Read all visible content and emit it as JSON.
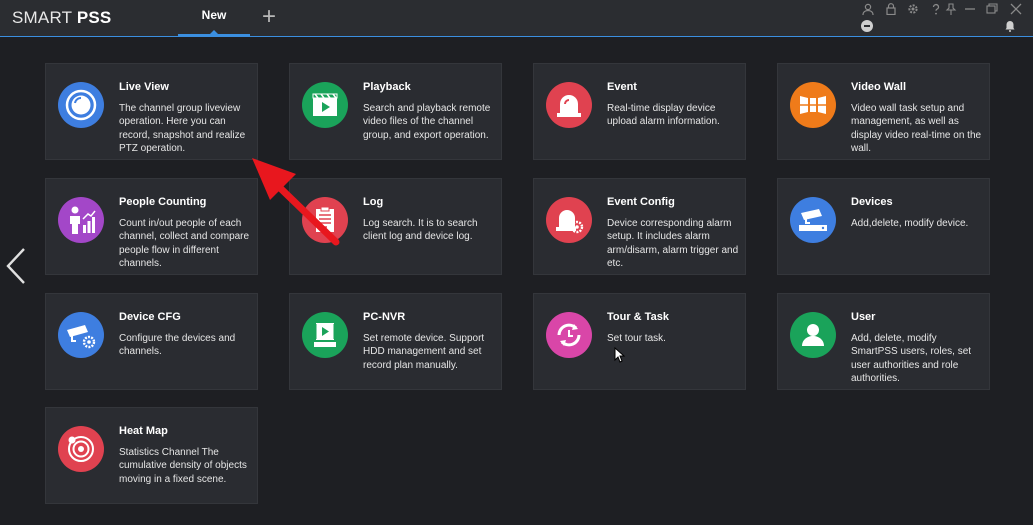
{
  "app": {
    "logo_part1": "SMART ",
    "logo_part2": "PSS",
    "active_tab": "New",
    "add_tab": "+"
  },
  "colors": {
    "live_view": "#3e7ee0",
    "playback": "#1aa35a",
    "event": "#e04250",
    "video_wall": "#ef7b1a",
    "people_counting": "#a347c8",
    "log": "#e04250",
    "event_config": "#e04250",
    "devices": "#3e7ee0",
    "device_cfg": "#3e7ee0",
    "pc_nvr": "#1aa35a",
    "tour_task": "#d946a8",
    "user": "#1aa35a",
    "heat_map": "#e04250"
  },
  "cards": [
    {
      "title": "Live View",
      "desc": "The channel group liveview operation. Here you can record, snapshot and realize PTZ operation.",
      "icon": "live-view-icon"
    },
    {
      "title": "Playback",
      "desc": "Search and playback remote video files of the channel group, and export operation.",
      "icon": "playback-icon"
    },
    {
      "title": "Event",
      "desc": "Real-time display device upload alarm information.",
      "icon": "alarm-light-icon"
    },
    {
      "title": "Video Wall",
      "desc": "Video wall task setup and management, as well as display video real-time on the wall.",
      "icon": "video-wall-icon"
    },
    {
      "title": "People Counting",
      "desc": "Count in/out people of each channel, collect and compare people flow in different channels.",
      "icon": "people-counting-icon"
    },
    {
      "title": "Log",
      "desc": "Log search. It is to search client log and device log.",
      "icon": "log-icon"
    },
    {
      "title": "Event Config",
      "desc": "Device corresponding alarm setup. It includes alarm arm/disarm, alarm trigger and etc.",
      "icon": "event-config-icon"
    },
    {
      "title": "Devices",
      "desc": "Add,delete, modify device.",
      "icon": "devices-icon"
    },
    {
      "title": "Device CFG",
      "desc": "Configure the devices and channels.",
      "icon": "device-cfg-icon"
    },
    {
      "title": "PC-NVR",
      "desc": "Set remote device. Support HDD management and set record plan manually.",
      "icon": "pc-nvr-icon"
    },
    {
      "title": "Tour & Task",
      "desc": "Set tour task.",
      "icon": "tour-task-icon"
    },
    {
      "title": "User",
      "desc": "Add, delete, modify SmartPSS users, roles, set user authorities and role authorities.",
      "icon": "user-icon"
    },
    {
      "title": "Heat Map",
      "desc": "Statistics Channel The cumulative density of objects moving in a fixed scene.",
      "icon": "heat-map-icon"
    }
  ]
}
